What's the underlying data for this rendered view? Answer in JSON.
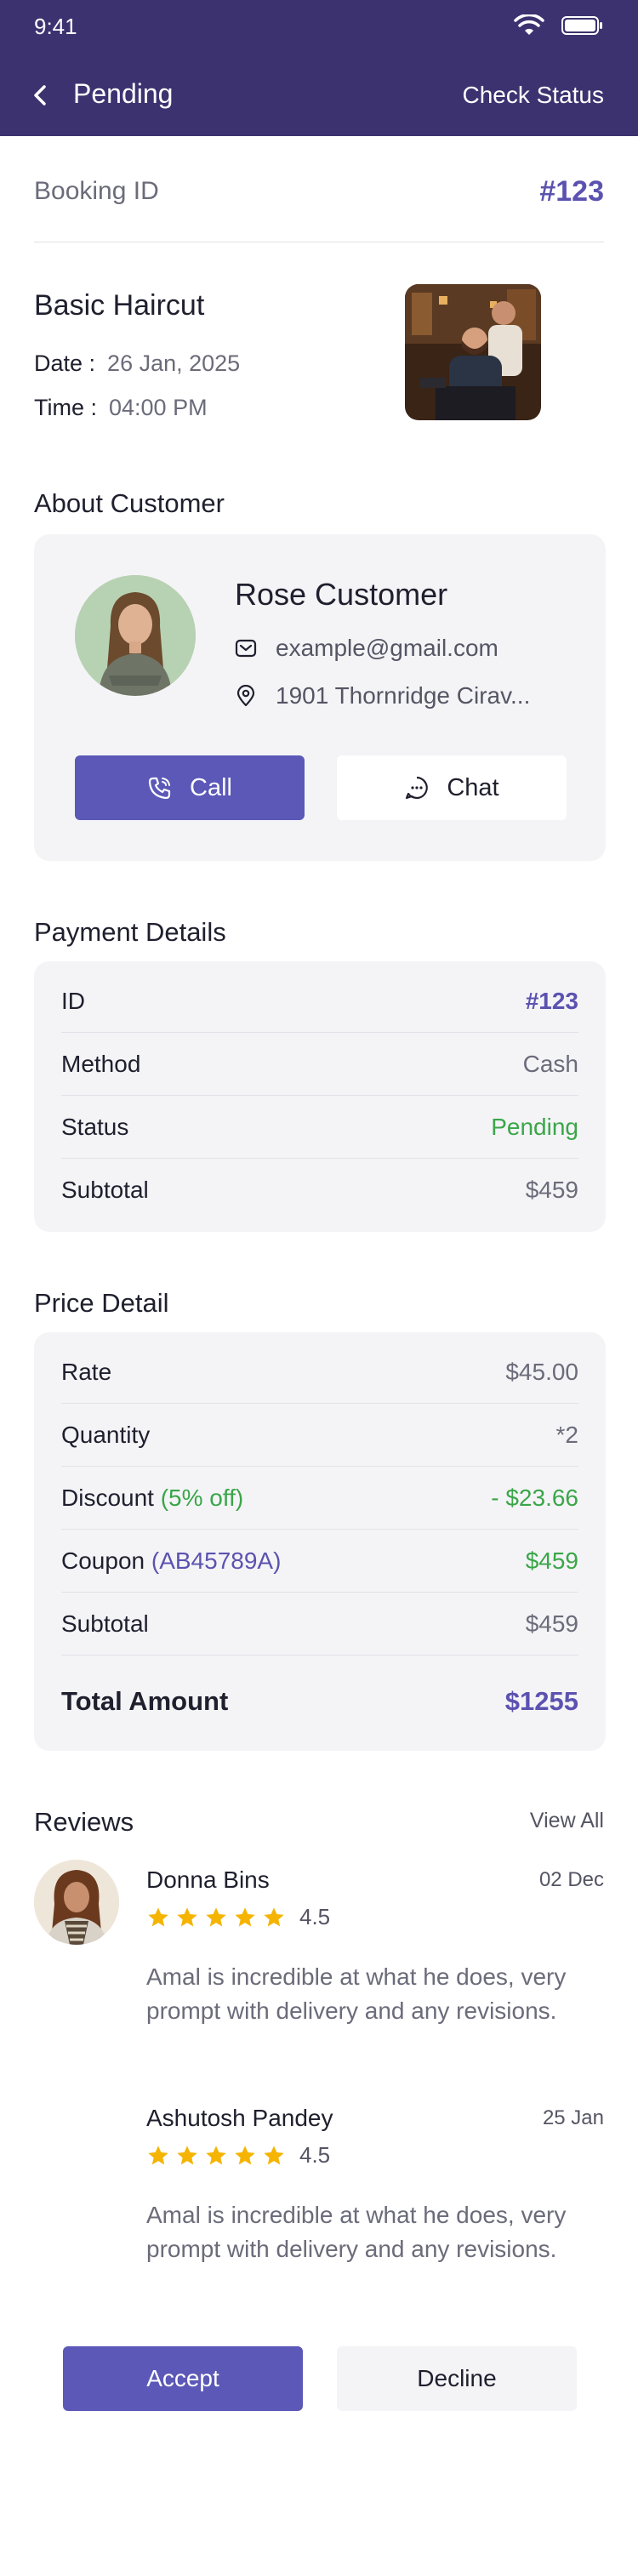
{
  "status_bar": {
    "time": "9:41"
  },
  "header": {
    "title": "Pending",
    "action": "Check Status"
  },
  "booking": {
    "label": "Booking ID",
    "id": "#123"
  },
  "service": {
    "name": "Basic Haircut",
    "date_label": "Date :",
    "date": "26 Jan, 2025",
    "time_label": "Time :",
    "time": "04:00 PM"
  },
  "customer": {
    "section_title": "About Customer",
    "name": "Rose Customer",
    "email": "example@gmail.com",
    "address": "1901 Thornridge Cirav...",
    "call_label": "Call",
    "chat_label": "Chat"
  },
  "payment": {
    "section_title": "Payment Details",
    "rows": [
      {
        "label": "ID",
        "value": "#123"
      },
      {
        "label": "Method",
        "value": "Cash"
      },
      {
        "label": "Status",
        "value": "Pending"
      },
      {
        "label": "Subtotal",
        "value": "$459"
      }
    ]
  },
  "price": {
    "section_title": "Price Detail",
    "rate_label": "Rate",
    "rate": "$45.00",
    "quantity_label": "Quantity",
    "quantity": "*2",
    "discount_label": "Discount",
    "discount_note": "(5% off)",
    "discount": "- $23.66",
    "coupon_label": "Coupon",
    "coupon_code": "(AB45789A)",
    "coupon": "$459",
    "subtotal_label": "Subtotal",
    "subtotal": "$459",
    "total_label": "Total Amount",
    "total": "$1255"
  },
  "reviews": {
    "section_title": "Reviews",
    "view_all": "View All",
    "items": [
      {
        "name": "Donna Bins",
        "date": "02 Dec",
        "rating": "4.5",
        "stars": 5,
        "text": "Amal is incredible at what he does, very prompt with delivery and any revisions."
      },
      {
        "name": "Ashutosh Pandey",
        "date": "25 Jan",
        "rating": "4.5",
        "stars": 5,
        "text": "Amal is incredible at what he does, very prompt with delivery and any revisions."
      }
    ]
  },
  "actions": {
    "accept": "Accept",
    "decline": "Decline"
  },
  "colors": {
    "header_bg": "#3d3270",
    "accent": "#5b58b8",
    "success": "#3aa648",
    "star": "#f5b400"
  }
}
